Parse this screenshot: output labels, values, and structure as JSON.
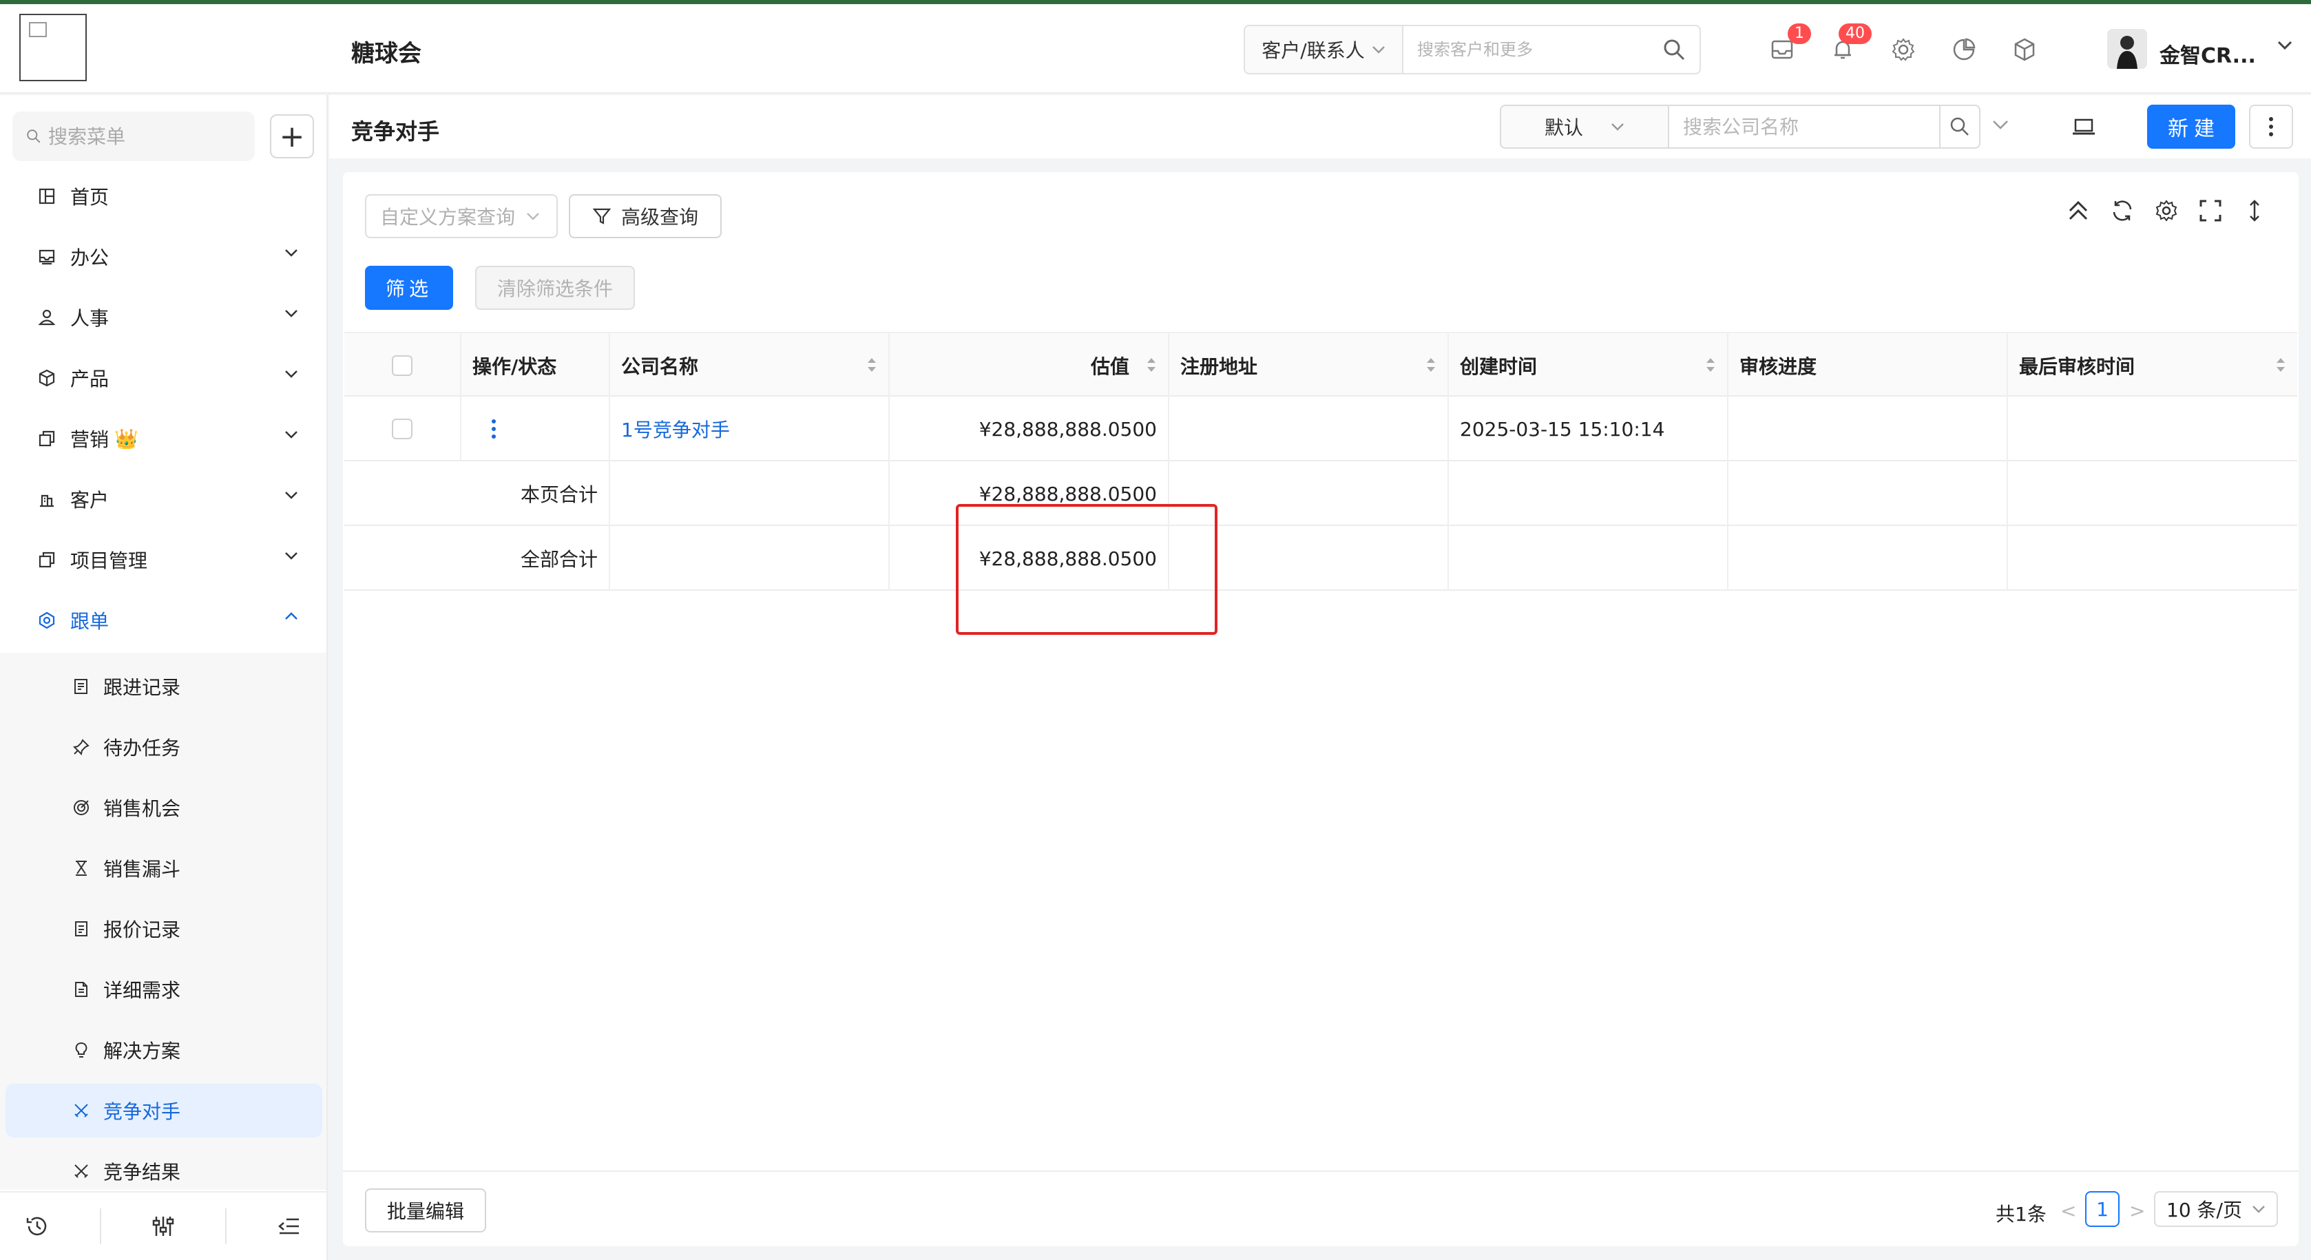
{
  "header": {
    "org_name": "糖球会",
    "search_type": "客户/联系人",
    "search_placeholder": "搜索客户和更多",
    "mail_badge": "1",
    "notify_badge": "40",
    "user_name": "金智CR..."
  },
  "sidebar": {
    "search_placeholder": "搜索菜单",
    "add_label": "+",
    "items": [
      {
        "label": "首页"
      },
      {
        "label": "办公"
      },
      {
        "label": "人事"
      },
      {
        "label": "产品"
      },
      {
        "label": "营销"
      },
      {
        "label": "客户"
      },
      {
        "label": "项目管理"
      },
      {
        "label": "跟单"
      }
    ],
    "crown": "👑",
    "sub_items": [
      {
        "label": "跟进记录"
      },
      {
        "label": "待办任务"
      },
      {
        "label": "销售机会"
      },
      {
        "label": "销售漏斗"
      },
      {
        "label": "报价记录"
      },
      {
        "label": "详细需求"
      },
      {
        "label": "解决方案"
      },
      {
        "label": "竞争对手"
      },
      {
        "label": "竞争结果"
      }
    ]
  },
  "page": {
    "title": "竞争对手",
    "view_select": "默认",
    "company_search_placeholder": "搜索公司名称",
    "new_label": "新建"
  },
  "filters": {
    "custom_query_placeholder": "自定义方案查询",
    "advanced_query": "高级查询",
    "filter_label": "筛选",
    "clear_label": "清除筛选条件"
  },
  "table": {
    "columns": [
      "操作/状态",
      "公司名称",
      "估值",
      "注册地址",
      "创建时间",
      "审核进度",
      "最后审核时间"
    ],
    "rows": [
      {
        "company": "1号竞争对手",
        "valuation": "¥28,888,888.0500",
        "address": "",
        "created": "2025-03-15 15:10:14",
        "review": "",
        "last_review": ""
      }
    ],
    "page_total_label": "本页合计",
    "page_total_value": "¥28,888,888.0500",
    "all_total_label": "全部合计",
    "all_total_value": "¥28,888,888.0500"
  },
  "footer": {
    "batch_edit": "批量编辑",
    "total": "共1条",
    "prev": "<",
    "current_page": "1",
    "next": ">",
    "page_size": "10 条/页"
  },
  "colors": {
    "primary": "#1677ff",
    "highlight": "#e02424",
    "badge": "#ff4d4f"
  }
}
